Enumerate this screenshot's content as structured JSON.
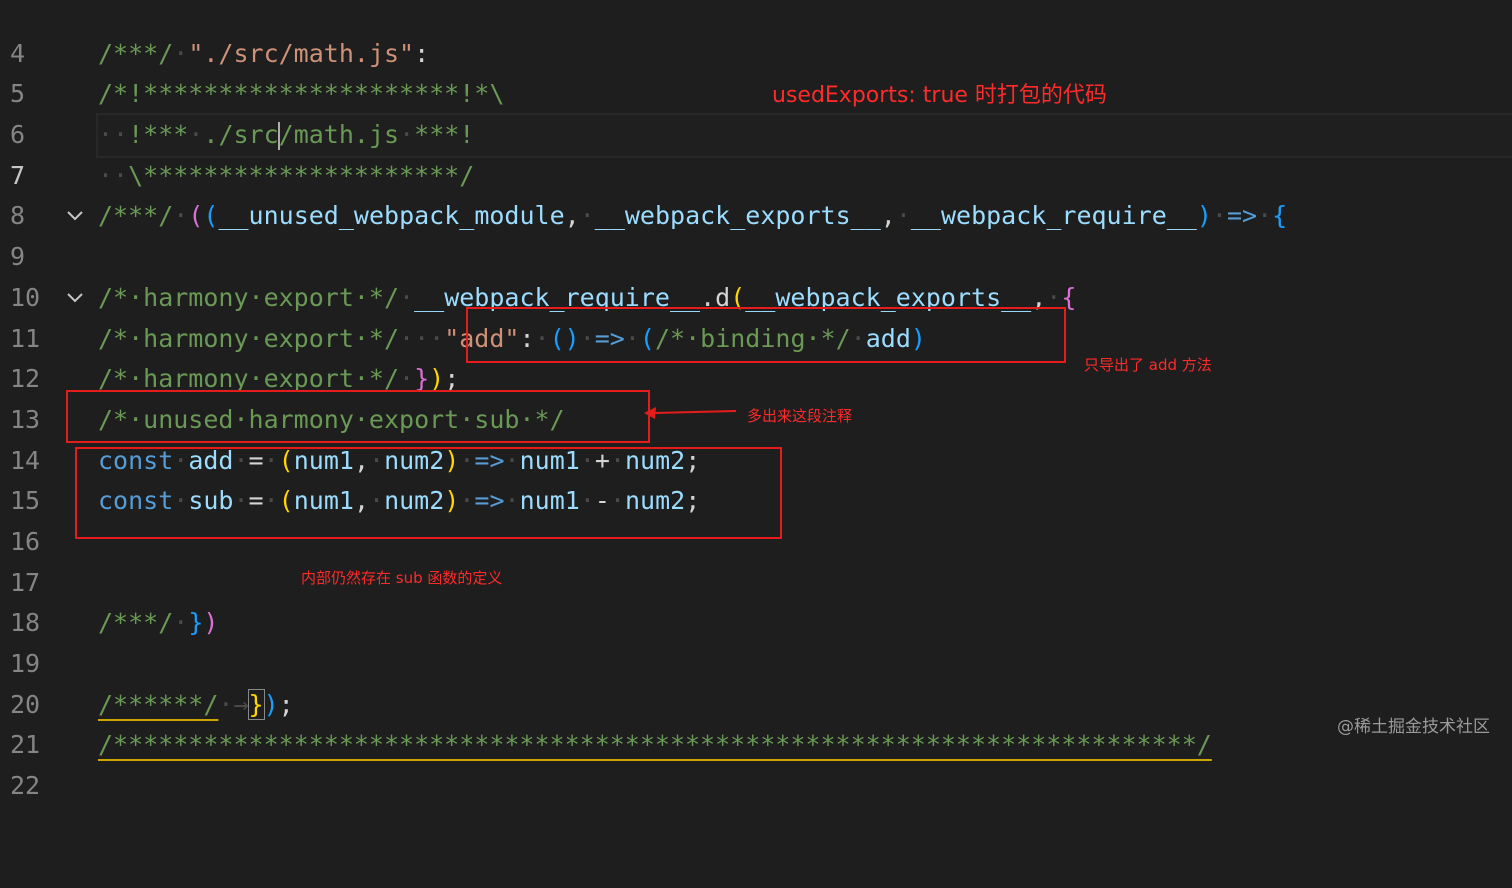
{
  "lines": [
    {
      "n": "4"
    },
    {
      "n": "5"
    },
    {
      "n": "6"
    },
    {
      "n": "7"
    },
    {
      "n": "8"
    },
    {
      "n": "9"
    },
    {
      "n": "10"
    },
    {
      "n": "11"
    },
    {
      "n": "12"
    },
    {
      "n": "13"
    },
    {
      "n": "14"
    },
    {
      "n": "15"
    },
    {
      "n": "16"
    },
    {
      "n": "17"
    },
    {
      "n": "18"
    },
    {
      "n": "19"
    },
    {
      "n": "20"
    },
    {
      "n": "21"
    },
    {
      "n": "22"
    }
  ],
  "annotations": {
    "title": "usedExports: true 时打包的代码",
    "only_add": "只导出了 add 方法",
    "extra_comment": "多出来这段注释",
    "sub_defined": "内部仍然存在 sub 函数的定义"
  },
  "watermark": "@稀土掘金技术社区",
  "colors": {
    "background": "#1e1e1e",
    "comment": "#6a9955",
    "string": "#ce9178",
    "keyword": "#569cd6",
    "variable": "#9cdcfe",
    "annotation": "#e51c1c"
  }
}
